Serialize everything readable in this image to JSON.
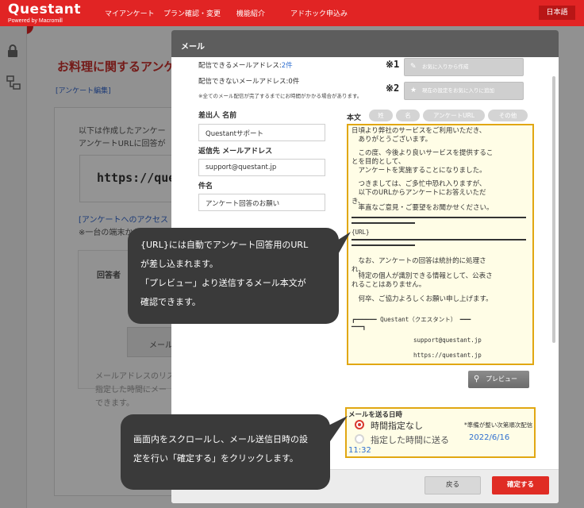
{
  "app": {
    "logo_name": "Questant",
    "logo_sub": "Powered by Macromill",
    "nav": [
      "マイアンケート",
      "プラン確認・変更",
      "機能紹介",
      "アドホック申込み"
    ],
    "language": "日本語"
  },
  "background_page": {
    "title": "お料理に関するアンケ",
    "edit_link": "[アンケート編集]",
    "intro_line_1": "以下は作成したアンケー",
    "intro_line_2": "アンケートURLに回答が",
    "url_fragment": "https://ques",
    "access_link": "[アンケートへのアクセス",
    "note": "※一台の端末からの回",
    "respondent_label": "回答者",
    "mail_btn": "メール",
    "list_line_1": "メールアドレスのリス",
    "list_line_2": "指定した時間にメー",
    "list_line_3": "できます。"
  },
  "modal": {
    "title": "メール",
    "sendable": {
      "label": "配信できるメールアドレス:",
      "count": "2件"
    },
    "unsendable": "配信できないメールアドレス:0件",
    "notice": "※全てのメール配信が完了するまでにお時間がかかる場合があります。",
    "marks": [
      "※1",
      "※2"
    ],
    "favorite_btn": "お気に入りから作成",
    "save_favorite_btn": "現在の設定をお気に入りに追加",
    "sender": {
      "label": "差出人 名前",
      "value": "Questantサポート"
    },
    "reply_to": {
      "label": "返信先 メールアドレス",
      "value": "support@questant.jp"
    },
    "subject": {
      "label": "件名",
      "value": "アンケート回答のお願い"
    },
    "body_label": "本文",
    "chips": [
      "姓",
      "名",
      "アンケートURL",
      "その他"
    ],
    "body_lines": [
      "日頃より弊社のサービスをご利用いただき、",
      "　ありがとうございます。",
      "　この度、今後より良いサービスを提供するこ",
      "とを目的として、",
      "　アンケートを実施することになりました。",
      "　つきましては、ご多忙中恐れ入りますが、",
      "　以下のURLからアンケートにお答えいただ",
      "き、",
      "　率直なご意見・ご要望をお聞かせください。",
      "{URL}",
      "　なお、アンケートの回答は統計的に処理さ",
      "れ、",
      "　特定の個人が識別できる情報として、公表さ",
      "れることはありません。",
      "　何卒、ご協力よろしくお願い申し上げます。",
      "┏━━━━━━ Questant（クエスタント） ━━━",
      "━━━┓",
      "support@questant.jp",
      "https://questant.jp"
    ],
    "preview_btn": "プレビュー",
    "send_time": {
      "title": "メールを送る日時",
      "opt_now": "時間指定なし",
      "opt_now_note": "*準備が整い次第順次配信",
      "opt_scheduled": "指定した時間に送る",
      "date": "2022/6/16",
      "time": "11:32"
    },
    "back_btn": "戻る",
    "confirm_btn": "確定する"
  },
  "callouts": {
    "url_note": [
      "{URL}には自動でアンケート回答用のURL",
      "が差し込まれます。",
      "「プレビュー」より送信するメール本文が",
      "確認できます。"
    ],
    "scroll_note": [
      "画面内をスクロールし、メール送信日時の設",
      "定を行い「確定する」をクリックします。"
    ]
  },
  "colors": {
    "brand_red": "#e12424",
    "highlight": "#e1a712",
    "link_blue": "#2f6fd0"
  }
}
